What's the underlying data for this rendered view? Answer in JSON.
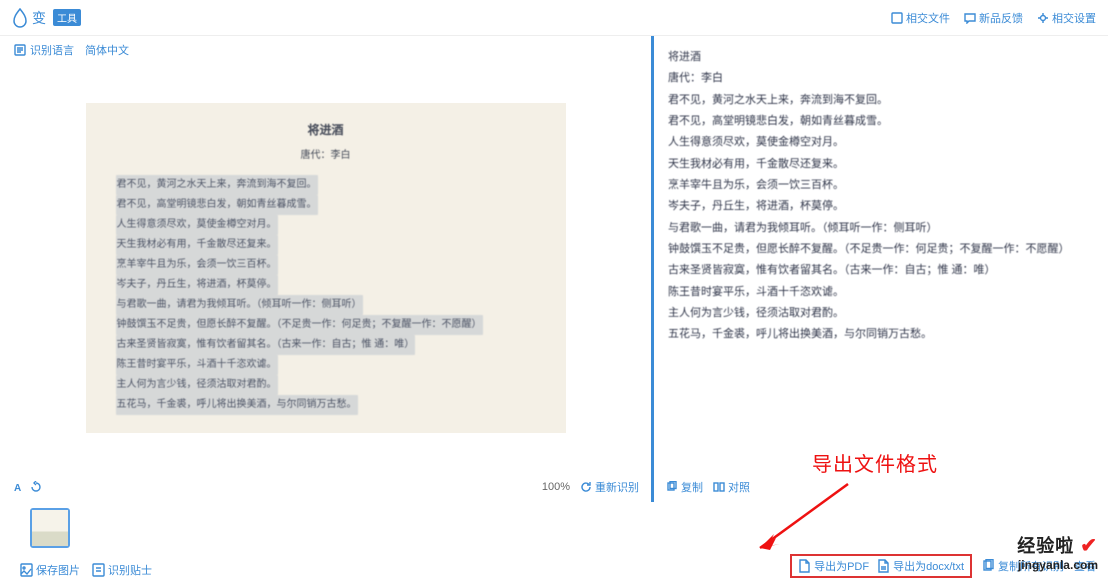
{
  "header": {
    "logo_text": "变",
    "logo_badge": "工具",
    "links": {
      "upload": "相交文件",
      "feedback": "新品反馈",
      "settings": "相交设置"
    }
  },
  "left": {
    "lang_label": "识别语言",
    "lang_value": "简体中文",
    "zoom": "100%",
    "reocr": "重新识别",
    "doc": {
      "title": "将进酒",
      "author": "唐代：李白",
      "lines": [
        "君不见，黄河之水天上来，奔流到海不复回。",
        "君不见，高堂明镜悲白发，朝如青丝暮成雪。",
        "人生得意须尽欢，莫使金樽空对月。",
        "天生我材必有用，千金散尽还复来。",
        "烹羊宰牛且为乐，会须一饮三百杯。",
        "岑夫子，丹丘生，将进酒，杯莫停。",
        "与君歌一曲，请君为我倾耳听。（倾耳听一作：侧耳听）",
        "钟鼓馔玉不足贵，但愿长醉不复醒。（不足贵一作：何足贵；不复醒一作：不愿醒）",
        "古来圣贤皆寂寞，惟有饮者留其名。（古来一作：自古；惟 通：唯）",
        "陈王昔时宴平乐，斗酒十千恣欢谑。",
        "主人何为言少钱，径须沽取对君酌。",
        "五花马，千金裘，呼儿将出换美酒，与尔同销万古愁。"
      ]
    }
  },
  "right": {
    "copy": "复制",
    "contrast": "对照",
    "lines": [
      "将进酒",
      "唐代：李白",
      "君不见，黄河之水天上来，奔流到海不复回。",
      "君不见，高堂明镜悲白发，朝如青丝暮成雪。",
      "人生得意须尽欢，莫使金樽空对月。",
      "天生我材必有用，千金散尽还复来。",
      "烹羊宰牛且为乐，会须一饮三百杯。",
      "岑夫子，丹丘生，将进酒，杯莫停。",
      "与君歌一曲，请君为我倾耳听。（倾耳听一作：侧耳听）",
      "钟鼓馔玉不足贵，但愿长醉不复醒。（不足贵一作：何足贵；不复醒一作：不愿醒）",
      "古来圣贤皆寂寞，惟有饮者留其名。（古来一作：自古；惟 通：唯）",
      "陈王昔时宴平乐，斗酒十千恣欢谑。",
      "主人何为言少钱，径须沽取对君酌。",
      "五花马，千金裘，呼儿将出换美酒，与尔同销万古愁。"
    ]
  },
  "annotation": "导出文件格式",
  "bottom": {
    "save_img": "保存图片",
    "ocr_tip": "识别贴士",
    "export_pdf": "导出为PDF",
    "export_docx": "导出为docx/txt",
    "copy_all": "复制所有识别",
    "view": "查看"
  },
  "watermark": {
    "line1": "经验啦",
    "line2": "jingyanla.com"
  }
}
